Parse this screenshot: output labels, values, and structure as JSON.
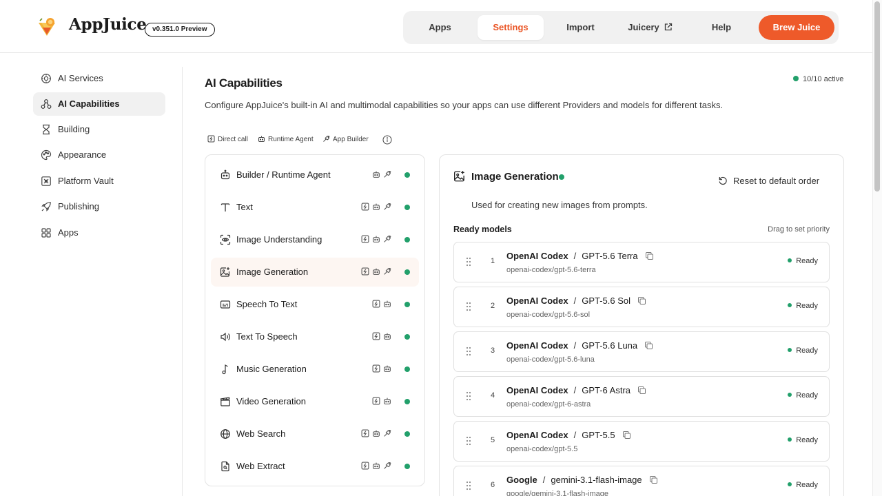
{
  "app": {
    "name": "AppJuice",
    "version": "v0.351.0 Preview"
  },
  "nav": {
    "items": [
      {
        "label": "Apps",
        "active": false
      },
      {
        "label": "Settings",
        "active": true
      },
      {
        "label": "Import",
        "active": false
      },
      {
        "label": "Juicery",
        "active": false,
        "external": true
      },
      {
        "label": "Help",
        "active": false
      }
    ],
    "cta_label": "Brew Juice",
    "accent": "#ee5a2a"
  },
  "sidebar": {
    "items": [
      {
        "label": "AI Services",
        "icon": "ai-services-icon",
        "active": false
      },
      {
        "label": "AI Capabilities",
        "icon": "ai-capabilities-icon",
        "active": true
      },
      {
        "label": "Building",
        "icon": "building-icon",
        "active": false
      },
      {
        "label": "Appearance",
        "icon": "palette-icon",
        "active": false
      },
      {
        "label": "Platform Vault",
        "icon": "vault-icon",
        "active": false
      },
      {
        "label": "Publishing",
        "icon": "rocket-icon",
        "active": false
      },
      {
        "label": "Apps",
        "icon": "apps-grid-icon",
        "active": false
      }
    ]
  },
  "main": {
    "title": "AI Capabilities",
    "active_count": "10/10 active",
    "description": "Configure AppJuice's built-in AI and multimodal capabilities so your apps can use different Providers and models for different tasks.",
    "legend": {
      "direct_call": "Direct call",
      "runtime_agent": "Runtime Agent",
      "app_builder": "App Builder"
    }
  },
  "capabilities": [
    {
      "label": "Builder / Runtime Agent",
      "icon": "robot-icon",
      "tags": [
        "runtime",
        "builder"
      ],
      "status": "active",
      "selected": false
    },
    {
      "label": "Text",
      "icon": "text-icon",
      "tags": [
        "direct",
        "runtime",
        "builder"
      ],
      "status": "active",
      "selected": false
    },
    {
      "label": "Image Understanding",
      "icon": "image-scan-icon",
      "tags": [
        "direct",
        "runtime",
        "builder"
      ],
      "status": "active",
      "selected": false
    },
    {
      "label": "Image Generation",
      "icon": "image-plus-icon",
      "tags": [
        "direct",
        "runtime",
        "builder"
      ],
      "status": "active",
      "selected": true
    },
    {
      "label": "Speech To Text",
      "icon": "captions-icon",
      "tags": [
        "direct",
        "runtime"
      ],
      "status": "active",
      "selected": false
    },
    {
      "label": "Text To Speech",
      "icon": "speaker-icon",
      "tags": [
        "direct",
        "runtime"
      ],
      "status": "active",
      "selected": false
    },
    {
      "label": "Music Generation",
      "icon": "music-note-icon",
      "tags": [
        "direct",
        "runtime"
      ],
      "status": "active",
      "selected": false
    },
    {
      "label": "Video Generation",
      "icon": "clapperboard-icon",
      "tags": [
        "direct",
        "runtime"
      ],
      "status": "active",
      "selected": false
    },
    {
      "label": "Web Search",
      "icon": "globe-icon",
      "tags": [
        "direct",
        "runtime",
        "builder"
      ],
      "status": "active",
      "selected": false
    },
    {
      "label": "Web Extract",
      "icon": "file-search-icon",
      "tags": [
        "direct",
        "runtime",
        "builder"
      ],
      "status": "active",
      "selected": false
    }
  ],
  "detail": {
    "title": "Image Generation",
    "reset_label": "Reset to default order",
    "description": "Used for creating new images from prompts.",
    "ready_label": "Ready models",
    "drag_hint": "Drag to set priority",
    "models": [
      {
        "num": "1",
        "provider": "OpenAI Codex",
        "name": "GPT-5.6 Terra",
        "id": "openai-codex/gpt-5.6-terra",
        "status": "Ready"
      },
      {
        "num": "2",
        "provider": "OpenAI Codex",
        "name": "GPT-5.6 Sol",
        "id": "openai-codex/gpt-5.6-sol",
        "status": "Ready"
      },
      {
        "num": "3",
        "provider": "OpenAI Codex",
        "name": "GPT-5.6 Luna",
        "id": "openai-codex/gpt-5.6-luna",
        "status": "Ready"
      },
      {
        "num": "4",
        "provider": "OpenAI Codex",
        "name": "GPT-6 Astra",
        "id": "openai-codex/gpt-6-astra",
        "status": "Ready"
      },
      {
        "num": "5",
        "provider": "OpenAI Codex",
        "name": "GPT-5.5",
        "id": "openai-codex/gpt-5.5",
        "status": "Ready"
      },
      {
        "num": "6",
        "provider": "Google",
        "name": "gemini-3.1-flash-image",
        "id": "google/gemini-3.1-flash-image",
        "status": "Ready"
      }
    ]
  },
  "colors": {
    "accent": "#ee5a2a",
    "status_green": "#22a06b"
  }
}
